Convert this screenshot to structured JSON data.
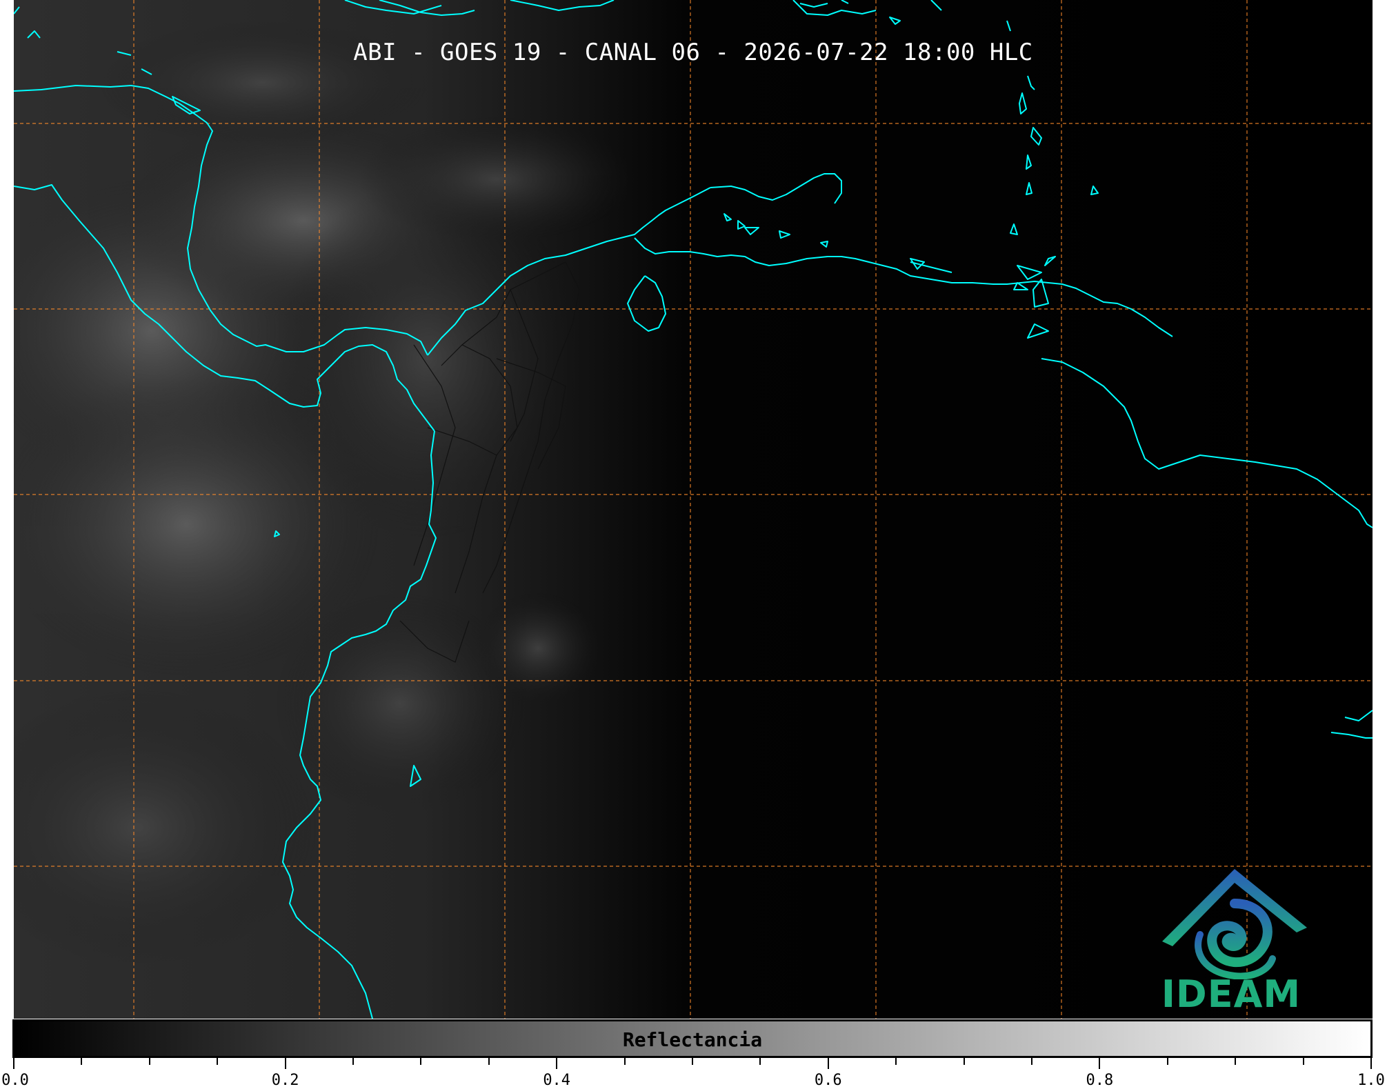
{
  "title": "ABI - GOES 19 - CANAL 06 - 2026-07-22 18:00 HLC",
  "map": {
    "coastline_color": "#00ffff",
    "border_color": "#111111",
    "gridline_color": "#ff8c2a",
    "background_color": "#000000"
  },
  "logo": {
    "text": "IDEAM",
    "text_color": "#1fae7d",
    "icon": "ideam-logo-icon"
  },
  "colorbar": {
    "label": "Reflectancia",
    "min": 0.0,
    "max": 1.0,
    "ticks": [
      {
        "value": 0.0,
        "label": "0.0"
      },
      {
        "value": 0.2,
        "label": "0.2"
      },
      {
        "value": 0.4,
        "label": "0.4"
      },
      {
        "value": 0.6,
        "label": "0.6"
      },
      {
        "value": 0.8,
        "label": "0.8"
      },
      {
        "value": 1.0,
        "label": "1.0"
      }
    ],
    "minor_step": 0.05,
    "colors": [
      "#000000",
      "#ffffff"
    ]
  }
}
